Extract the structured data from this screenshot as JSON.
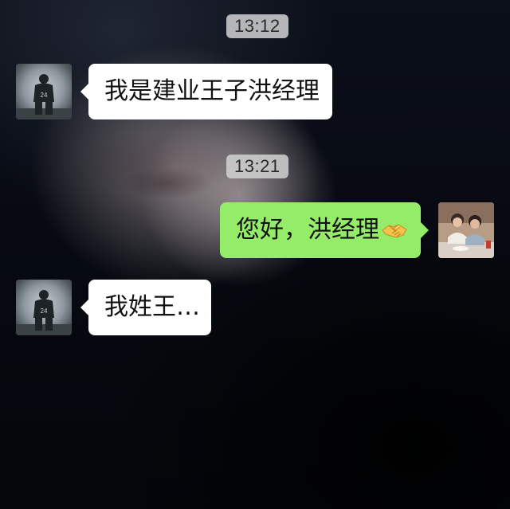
{
  "chat": {
    "messages": [
      {
        "timestamp": "13:12",
        "side": "left",
        "text": "我是建业王子洪经理",
        "avatar": "basketball-player-24-avatar"
      },
      {
        "timestamp": "13:21",
        "side": "right",
        "text": "您好，洪经理",
        "emoji": "handshake-emoji",
        "avatar": "two-people-photo-avatar"
      },
      {
        "side": "left",
        "text": "我姓王…",
        "avatar": "basketball-player-24-avatar"
      }
    ]
  },
  "colors": {
    "incoming_bubble": "#ffffff",
    "outgoing_bubble": "#95ec69",
    "timestamp_bg": "#d2d2d2"
  }
}
